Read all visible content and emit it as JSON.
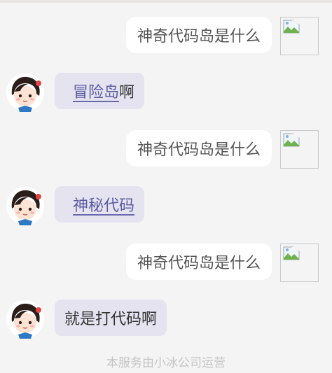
{
  "messages": [
    {
      "role": "user",
      "text": "神奇代码岛是什么"
    },
    {
      "role": "bot",
      "link": "冒险岛",
      "suffix": "啊"
    },
    {
      "role": "user",
      "text": "神奇代码岛是什么"
    },
    {
      "role": "bot",
      "link": "神秘代码",
      "suffix": ""
    },
    {
      "role": "user",
      "text": "神奇代码岛是什么"
    },
    {
      "role": "bot",
      "link": "",
      "suffix": "就是打代码啊"
    }
  ],
  "footer": {
    "text": "本服务由小冰公司运营"
  },
  "colors": {
    "background": "#f4f4f4",
    "bot_bubble": "#e4e3ef",
    "user_bubble": "#ffffff",
    "link": "#5c5ba3"
  },
  "icons": {
    "user_avatar": "broken-image-icon",
    "bot_avatar": "girl-avatar-icon"
  }
}
